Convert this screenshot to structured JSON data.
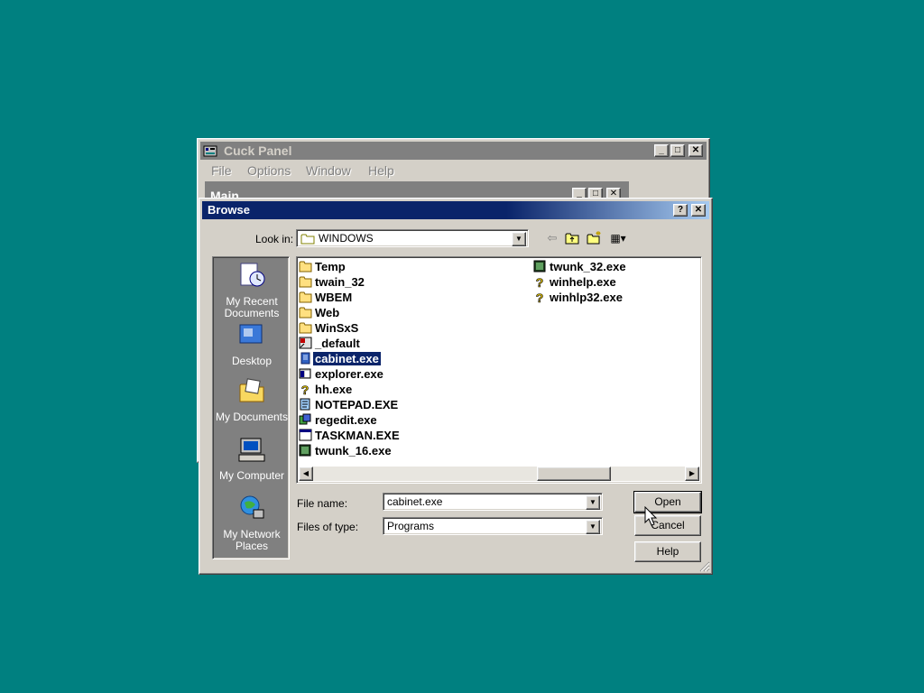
{
  "background_window": {
    "title": "Cuck Panel",
    "menu": [
      "File",
      "Options",
      "Window",
      "Help"
    ],
    "child_title": "Main"
  },
  "dialog": {
    "title": "Browse",
    "look_in_label": "Look in:",
    "look_in_value": "WINDOWS",
    "places": [
      {
        "label_line1": "My Recent",
        "label_line2": "Documents",
        "icon": "recent-documents-icon"
      },
      {
        "label_line1": "Desktop",
        "label_line2": "",
        "icon": "desktop-icon"
      },
      {
        "label_line1": "My Documents",
        "label_line2": "",
        "icon": "my-documents-icon"
      },
      {
        "label_line1": "My Computer",
        "label_line2": "",
        "icon": "my-computer-icon"
      },
      {
        "label_line1": "My Network",
        "label_line2": "Places",
        "icon": "network-places-icon"
      }
    ],
    "files_col1": [
      {
        "name": "Temp",
        "icon": "folder"
      },
      {
        "name": "twain_32",
        "icon": "folder"
      },
      {
        "name": "WBEM",
        "icon": "folder"
      },
      {
        "name": "Web",
        "icon": "folder"
      },
      {
        "name": "WinSxS",
        "icon": "folder"
      },
      {
        "name": "_default",
        "icon": "shortcut"
      },
      {
        "name": "cabinet.exe",
        "icon": "exe-blue",
        "selected": true
      },
      {
        "name": "explorer.exe",
        "icon": "exe-explorer"
      },
      {
        "name": "hh.exe",
        "icon": "help"
      },
      {
        "name": "NOTEPAD.EXE",
        "icon": "notepad"
      },
      {
        "name": "regedit.exe",
        "icon": "regedit"
      },
      {
        "name": "TASKMAN.EXE",
        "icon": "window"
      },
      {
        "name": "twunk_16.exe",
        "icon": "twain"
      }
    ],
    "files_col2": [
      {
        "name": "twunk_32.exe",
        "icon": "twain"
      },
      {
        "name": "winhelp.exe",
        "icon": "help"
      },
      {
        "name": "winhlp32.exe",
        "icon": "help"
      }
    ],
    "file_name_label": "File name:",
    "file_name_value": "cabinet.exe",
    "files_of_type_label": "Files of type:",
    "files_of_type_value": "Programs",
    "open_label": "Open",
    "cancel_label": "Cancel",
    "help_label": "Help"
  },
  "colors": {
    "desktop": "#008080",
    "active_title": "#0a246a",
    "inactive_title": "#808080",
    "face": "#d4d0c8"
  }
}
